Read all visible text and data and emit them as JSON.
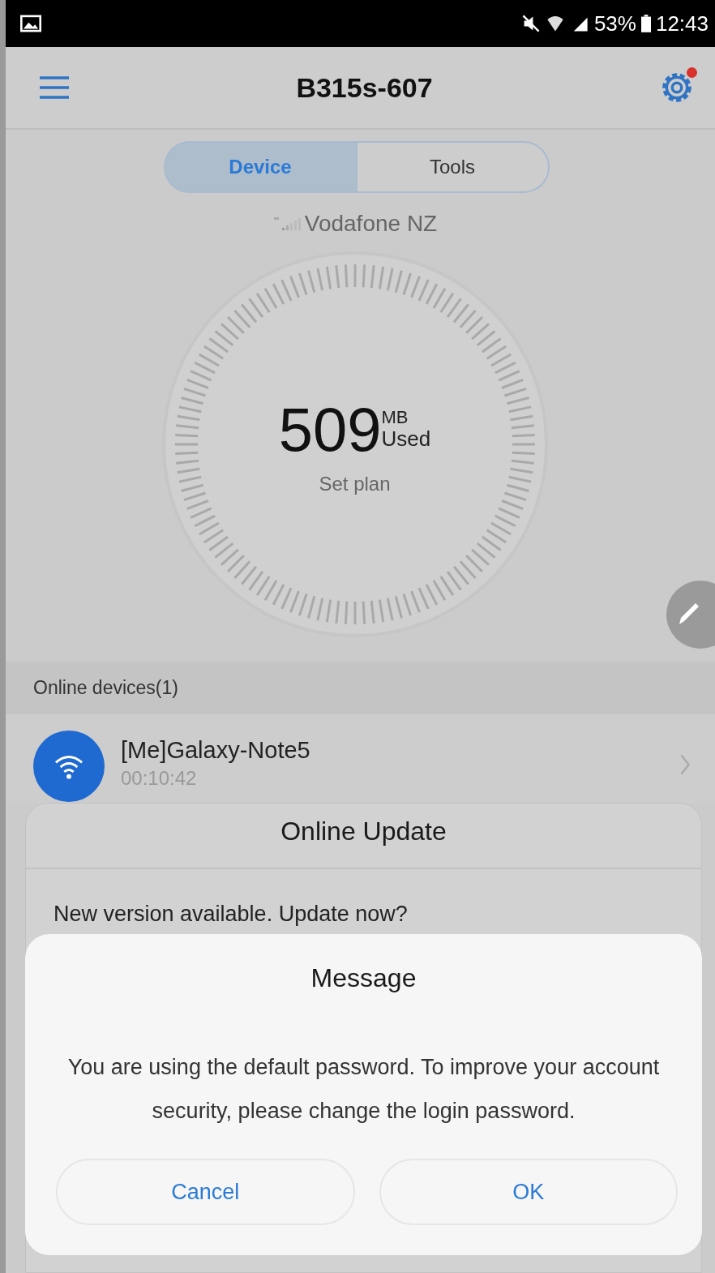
{
  "status_bar": {
    "battery": "53%",
    "time": "12:43"
  },
  "header": {
    "title": "B315s-607",
    "settings_badge": true
  },
  "tabs": [
    {
      "label": "Device",
      "selected": true
    },
    {
      "label": "Tools",
      "selected": false
    }
  ],
  "network": {
    "name": "Vodafone NZ"
  },
  "usage": {
    "value": "509",
    "unit": "MB",
    "label": "Used",
    "action": "Set plan"
  },
  "online_devices": {
    "title": "Online devices(1)",
    "items": [
      {
        "name": "[Me]Galaxy-Note5",
        "duration": "00:10:42"
      }
    ]
  },
  "update_dialog": {
    "title": "Online Update",
    "text": "New version available. Update now?"
  },
  "message_dialog": {
    "title": "Message",
    "text": "You are using the default password. To improve your account security, please change the login password.",
    "buttons": [
      "Cancel",
      "OK"
    ]
  }
}
